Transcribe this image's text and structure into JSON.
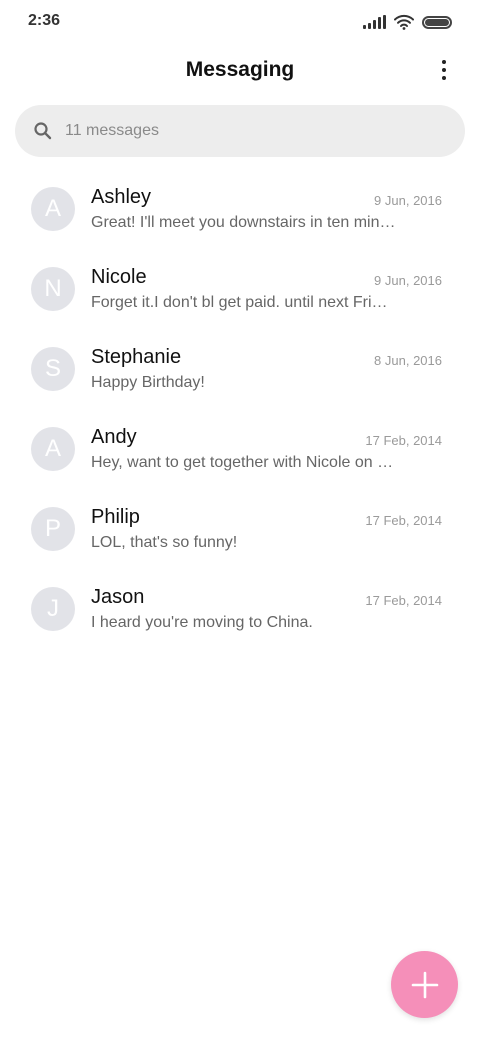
{
  "status_bar": {
    "time": "2:36",
    "icons": [
      "signal-icon",
      "wifi-icon",
      "battery-icon"
    ]
  },
  "header": {
    "title": "Messaging",
    "more_icon": "more-vertical-icon"
  },
  "search": {
    "placeholder": "11 messages",
    "icon": "search-icon"
  },
  "conversations": [
    {
      "initial": "A",
      "name": "Ashley",
      "date": "9 Jun, 2016",
      "preview": "Great! I'll meet you downstairs in ten minutes."
    },
    {
      "initial": "N",
      "name": "Nicole",
      "date": "9 Jun, 2016",
      "preview": "Forget it.I don't bl get paid. until next Friday."
    },
    {
      "initial": "S",
      "name": "Stephanie",
      "date": "8 Jun, 2016",
      "preview": "Happy Birthday!"
    },
    {
      "initial": "A",
      "name": "Andy",
      "date": "17 Feb, 2014",
      "preview": "Hey, want to get together with Nicole on Saturday?"
    },
    {
      "initial": "P",
      "name": "Philip",
      "date": "17 Feb, 2014",
      "preview": "LOL, that's so funny!"
    },
    {
      "initial": "J",
      "name": "Jason",
      "date": "17 Feb, 2014",
      "preview": "I heard you're moving to China."
    }
  ],
  "fab": {
    "icon": "plus-icon"
  },
  "colors": {
    "accent": "#f58fb9",
    "avatar_bg": "#e2e3e8",
    "search_bg": "#ededed"
  }
}
